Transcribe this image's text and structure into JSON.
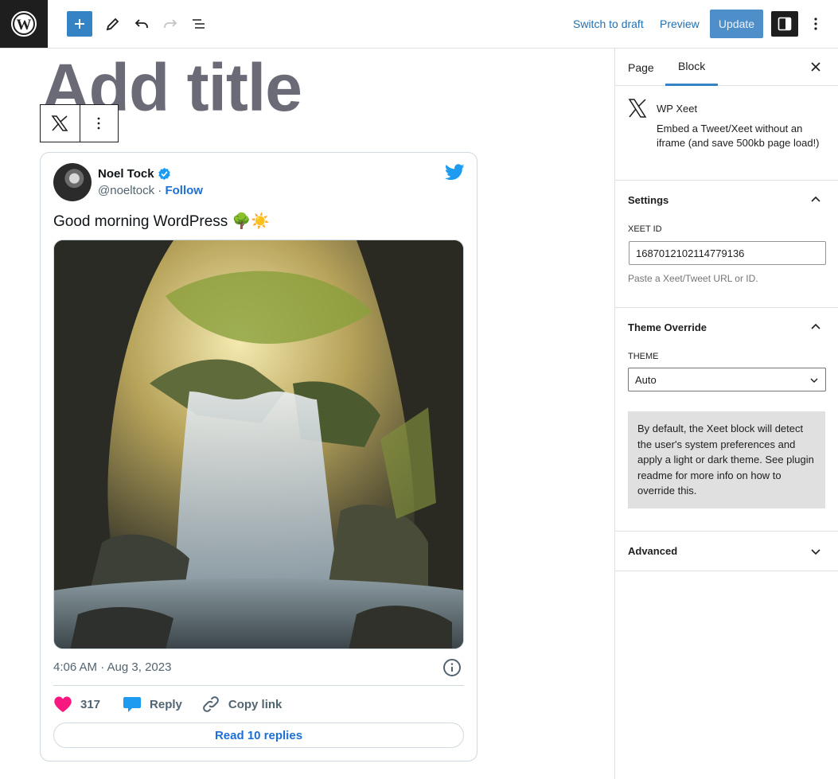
{
  "topbar": {
    "switch_to_draft": "Switch to draft",
    "preview": "Preview",
    "update": "Update",
    "icons": [
      "wordpress-logo",
      "add-block-icon",
      "pencil-icon",
      "undo-icon",
      "redo-icon",
      "list-view-icon",
      "sidebar-toggle-icon",
      "more-options-icon"
    ]
  },
  "editor": {
    "title_placeholder": "Add title"
  },
  "tweet": {
    "author_name": "Noel Tock",
    "handle": "@noeltock",
    "separator": " · ",
    "follow": "Follow",
    "text": "Good morning WordPress 🌳☀️",
    "timestamp": "4:06 AM · Aug 3, 2023",
    "likes": "317",
    "reply": "Reply",
    "copy_link": "Copy link",
    "read_replies": "Read 10 replies"
  },
  "sidebar": {
    "tabs": [
      {
        "label": "Page",
        "active": false
      },
      {
        "label": "Block",
        "active": true
      }
    ],
    "block": {
      "name": "WP Xeet",
      "description": "Embed a Tweet/Xeet without an iframe (and save 500kb page load!)"
    },
    "settings": {
      "heading": "Settings",
      "field_label": "XEET ID",
      "value": "1687012102114779136",
      "help": "Paste a Xeet/Tweet URL or ID."
    },
    "theme_override": {
      "heading": "Theme Override",
      "field_label": "THEME",
      "selected": "Auto",
      "notice": "By default, the Xeet block will detect the user's system preferences and apply a light or dark theme. See plugin readme for more info on how to override this."
    },
    "advanced": {
      "heading": "Advanced"
    }
  },
  "colors": {
    "accent": "#3582c4",
    "link": "#2271b1",
    "twitter_blue": "#1d9bf0",
    "heart": "#f91880"
  }
}
